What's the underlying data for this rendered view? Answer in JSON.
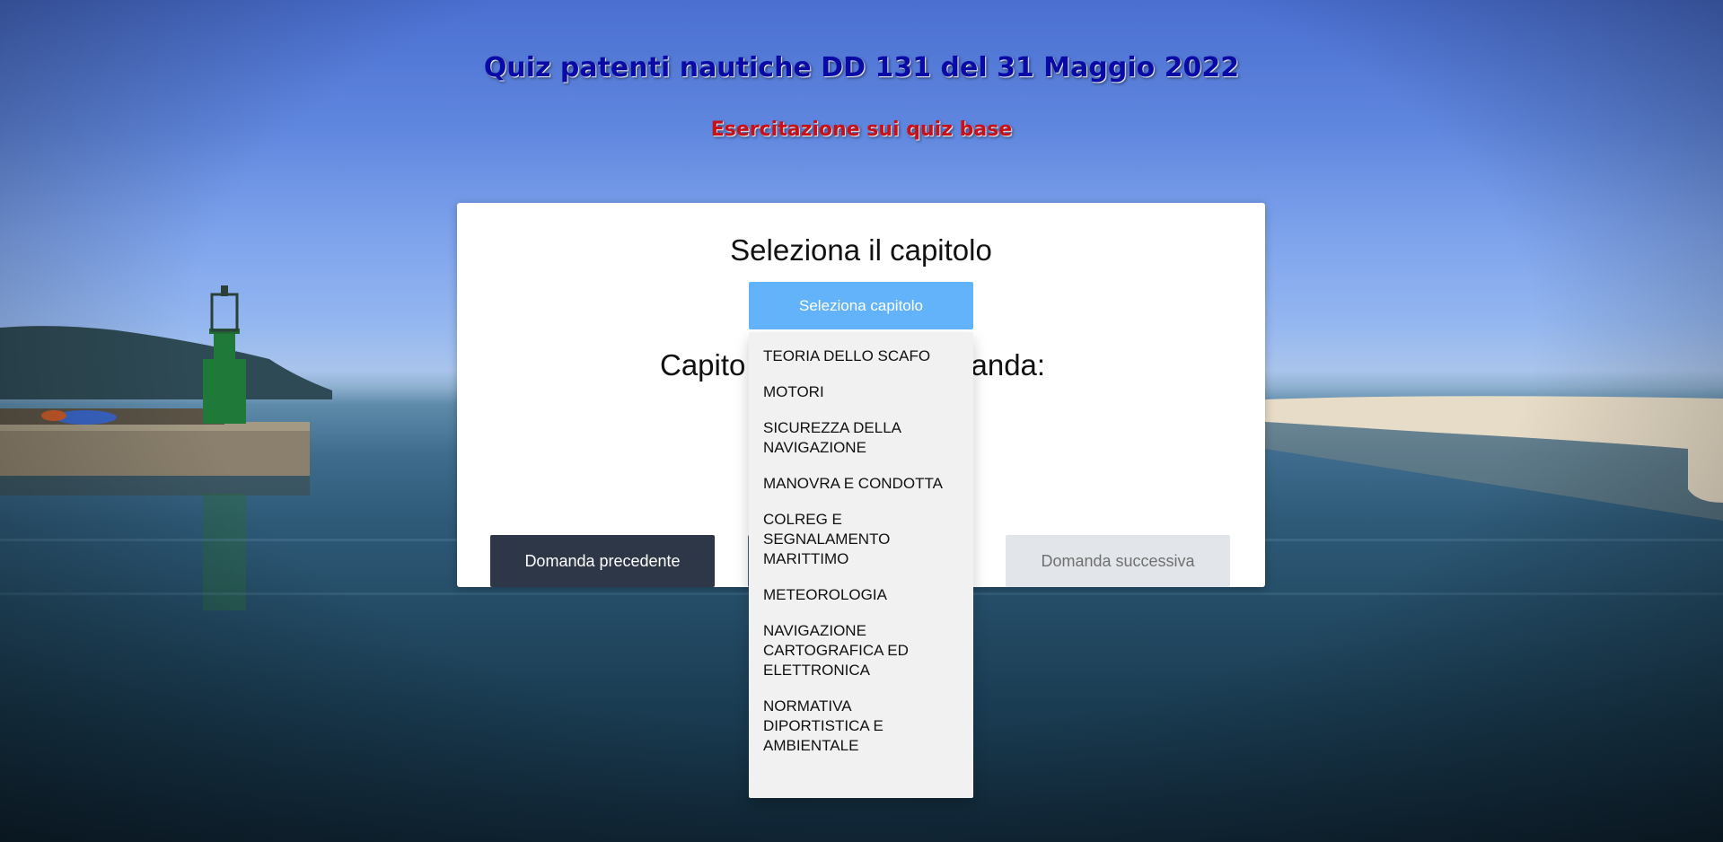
{
  "header": {
    "title": "Quiz patenti nautiche DD 131 del 31 Maggio 2022",
    "subtitle": "Esercitazione sui quiz base"
  },
  "card": {
    "heading": "Seleziona il capitolo",
    "chapter_label_left": "Capito",
    "chapter_label_right": "manda:",
    "prev_button": "Domanda precedente",
    "next_button": "Domanda successiva"
  },
  "dropdown": {
    "button_label": "Seleziona capitolo",
    "items": [
      "TEORIA DELLO SCAFO",
      "MOTORI",
      "SICUREZZA DELLA NAVIGAZIONE",
      "MANOVRA E CONDOTTA",
      "COLREG E SEGNALAMENTO MARITTIMO",
      "METEOROLOGIA",
      "NAVIGAZIONE CARTOGRAFICA ED ELETTRONICA",
      "NORMATIVA DIPORTISTICA E AMBIENTALE"
    ]
  },
  "colors": {
    "title": "#0a0aa6",
    "subtitle": "#c8101a",
    "dropdown_button": "#63b3fb",
    "prev_button": "#2d3748",
    "next_button": "#e2e5ea"
  }
}
